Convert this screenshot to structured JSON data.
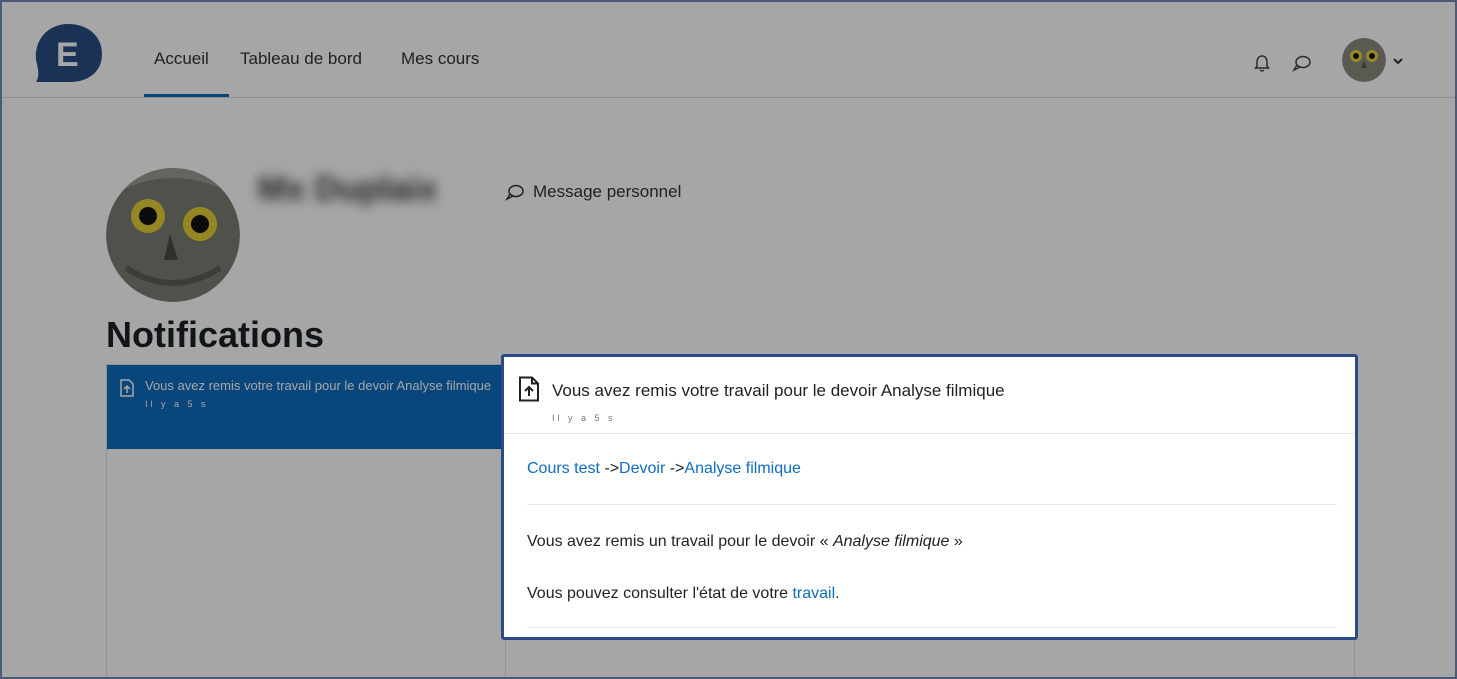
{
  "nav": {
    "links": [
      {
        "label": "Accueil"
      },
      {
        "label": "Tableau de bord"
      },
      {
        "label": "Mes cours"
      }
    ],
    "icons": [
      "bell-icon",
      "chat-bubble-icon",
      "user-avatar",
      "chevron-down-icon"
    ],
    "logo_letter": "E",
    "accent": "#0f6cbf"
  },
  "profile": {
    "name": "Mx Duplaix",
    "message_label": "Message personnel"
  },
  "notifications": {
    "title": "Notifications",
    "items": [
      {
        "text": "Vous avez remis votre travail pour le devoir Analyse filmique",
        "time": "Il y a 5 s"
      }
    ]
  },
  "detail": {
    "title": "Vous avez remis votre travail pour le devoir Analyse filmique",
    "time": "Il y a 5 s",
    "breadcrumb": {
      "course": "Cours test",
      "sep1": " ->",
      "module": "Devoir",
      "sep2": " ->",
      "activity": "Analyse filmique"
    },
    "line1_prefix": "Vous avez remis un travail pour le devoir « ",
    "line1_emph": "Analyse filmique",
    "line1_suffix": " »",
    "line2_prefix": "Vous pouvez consulter l'état de votre ",
    "line2_link": "travail",
    "line2_suffix": "."
  }
}
